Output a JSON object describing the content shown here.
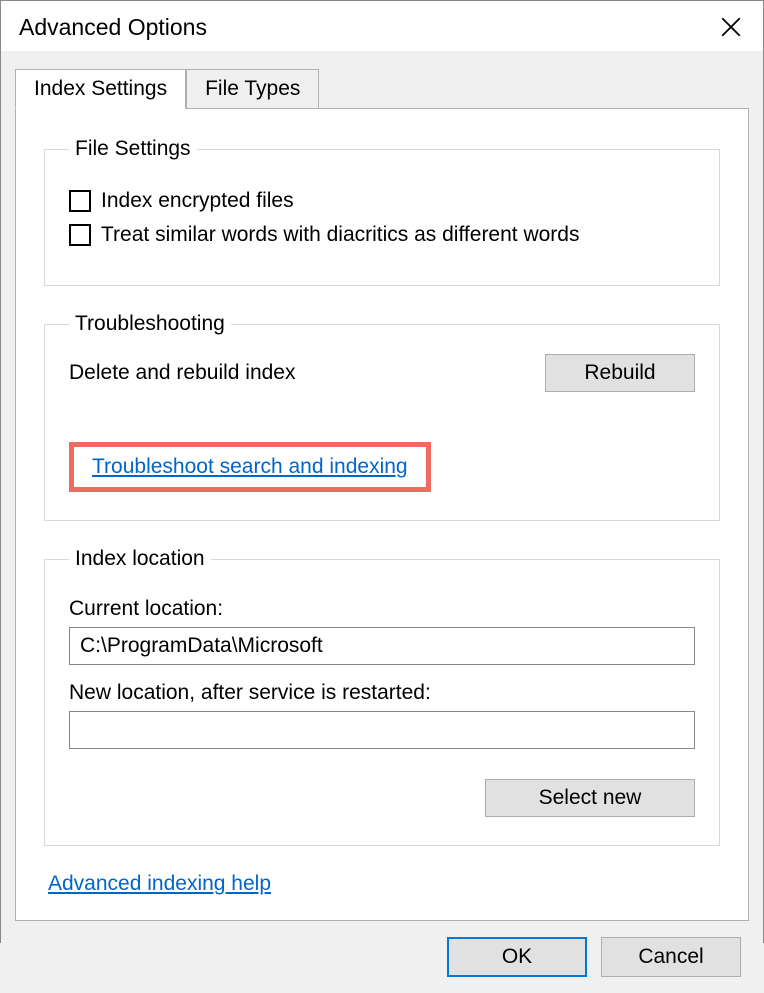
{
  "dialog": {
    "title": "Advanced Options"
  },
  "tabs": {
    "index_settings": "Index Settings",
    "file_types": "File Types"
  },
  "file_settings": {
    "legend": "File Settings",
    "encrypted": "Index encrypted files",
    "diacritics": "Treat similar words with diacritics as different words"
  },
  "troubleshooting": {
    "legend": "Troubleshooting",
    "rebuild_label": "Delete and rebuild index",
    "rebuild_button": "Rebuild",
    "troubleshoot_link": "Troubleshoot search and indexing"
  },
  "index_location": {
    "legend": "Index location",
    "current_label": "Current location:",
    "current_value": "C:\\ProgramData\\Microsoft",
    "new_label": "New location, after service is restarted:",
    "new_value": "",
    "select_new_button": "Select new"
  },
  "help_link": "Advanced indexing help",
  "buttons": {
    "ok": "OK",
    "cancel": "Cancel"
  }
}
